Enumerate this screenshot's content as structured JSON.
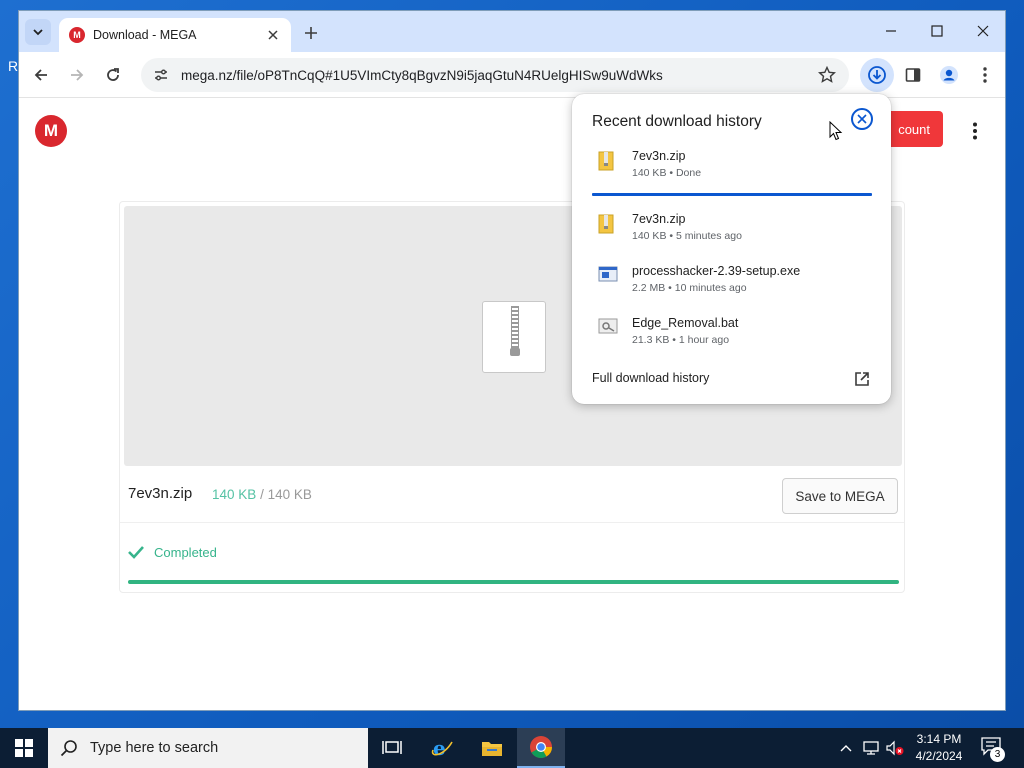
{
  "browser": {
    "tab_title": "Download - MEGA",
    "tab_favicon_letter": "M",
    "url": "mega.nz/file/oP8TnCqQ#1U5VImCty8qBgvzN9i5jaqGtuN4RUelgHISw9uWdWks"
  },
  "page": {
    "logo_letter": "M",
    "create_account_label": "count",
    "file_name": "7ev3n.zip",
    "downloaded_size": "140 KB",
    "size_separator": "/",
    "total_size": "140 KB",
    "save_button_label": "Save to MEGA",
    "status_text": "Completed",
    "progress_fraction": 1.0
  },
  "download_popup": {
    "title": "Recent download history",
    "items": [
      {
        "name": "7ev3n.zip",
        "meta": "140 KB • Done",
        "icon": "zip-file-icon"
      },
      {
        "name": "7ev3n.zip",
        "meta": "140 KB • 5 minutes ago",
        "icon": "zip-file-icon"
      },
      {
        "name": "processhacker-2.39-setup.exe",
        "meta": "2.2 MB • 10 minutes ago",
        "icon": "exe-file-icon"
      },
      {
        "name": "Edge_Removal.bat",
        "meta": "21.3 KB • 1 hour ago",
        "icon": "bat-file-icon"
      }
    ],
    "full_history_label": "Full download history"
  },
  "taskbar": {
    "search_placeholder": "Type here to search",
    "time": "3:14 PM",
    "date": "4/2/2024",
    "notification_count": "3"
  },
  "colors": {
    "mega_red": "#d9272e",
    "chrome_blue": "#0b57d0",
    "progress_green": "#31b481"
  }
}
